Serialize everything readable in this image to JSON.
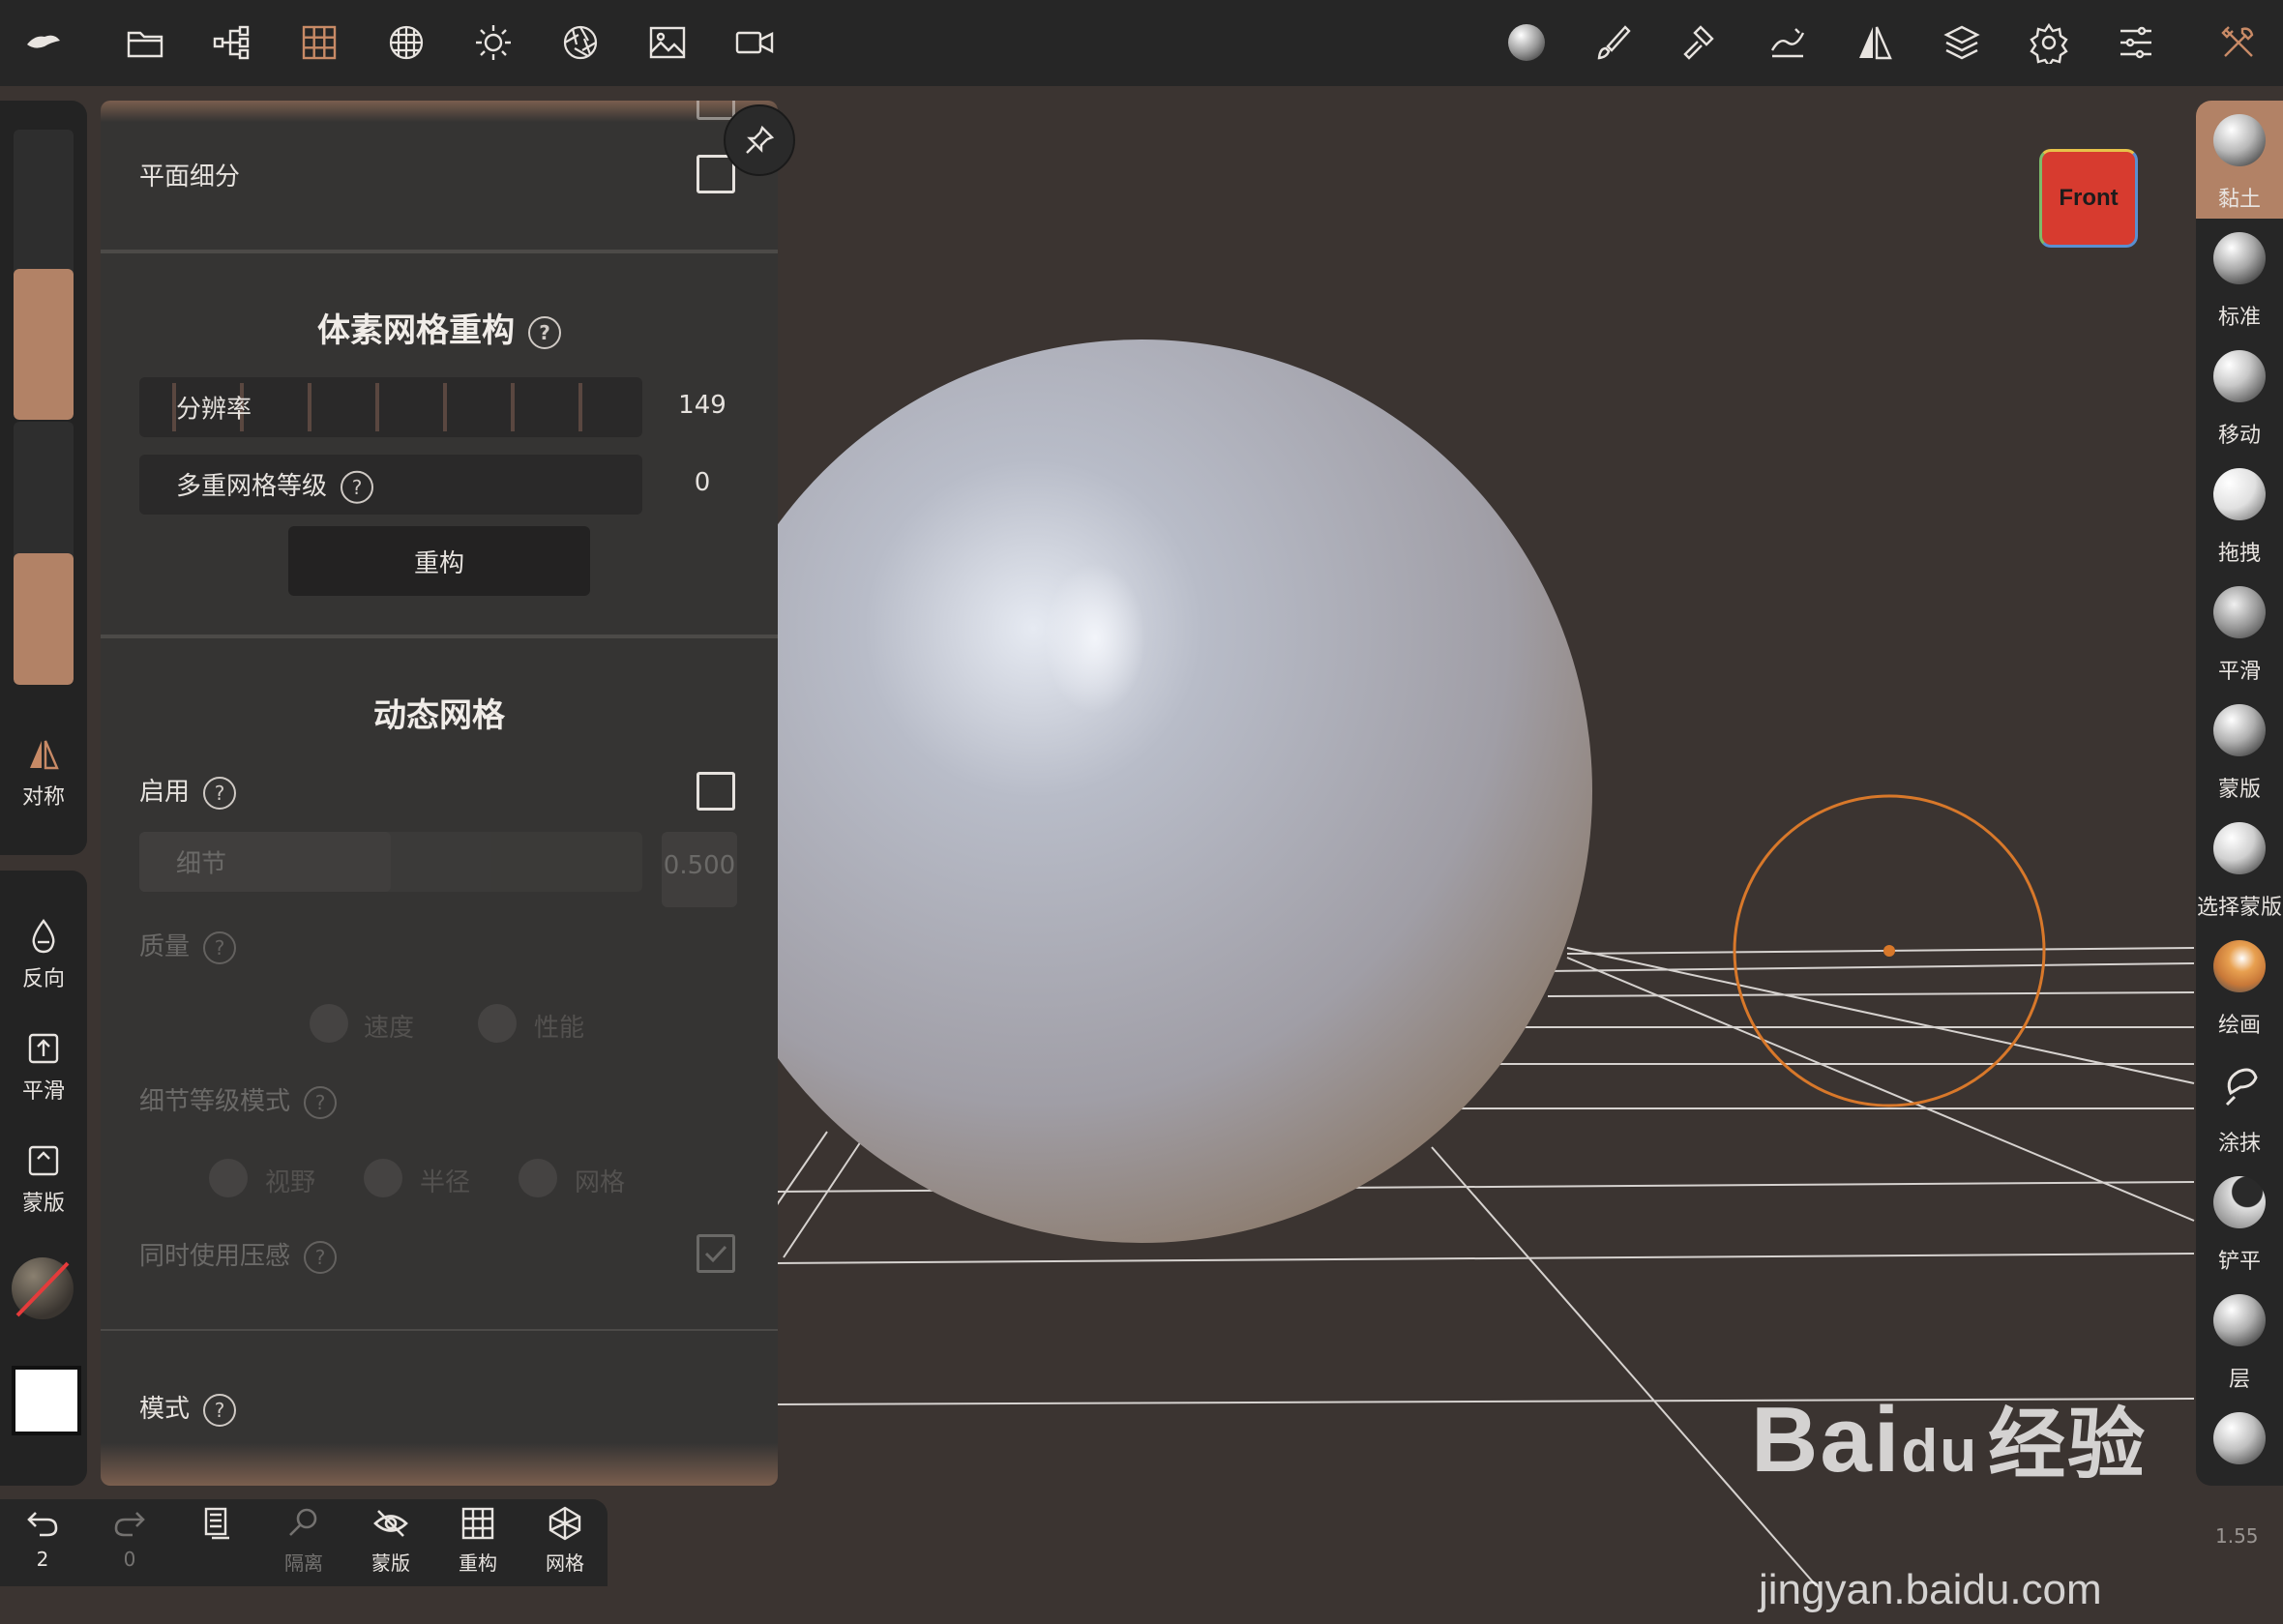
{
  "colors": {
    "accent": "#b28266",
    "brush_ring": "#d8782a",
    "front_cube": "#d73b2f",
    "toolbar_bg": "#262626",
    "viewport_bg": "#3b3431"
  },
  "toolbar": {
    "left_icons": [
      "logo-icon",
      "folder-icon",
      "scene-tree-icon",
      "grid-icon",
      "sphere-grid-icon",
      "sun-icon",
      "aperture-icon",
      "image-icon",
      "video-icon"
    ],
    "right_icons": [
      "material-ball-icon",
      "brush-icon",
      "hammer-icon",
      "stroke-icon",
      "symmetry-icon",
      "layers-icon",
      "gear-icon",
      "sliders-icon",
      "tools-icon"
    ]
  },
  "left_panel": {
    "radius_level": 0.52,
    "intensity_level": 0.5,
    "symmetry_label": "对称",
    "tools": [
      {
        "label": "反向",
        "icon": "drop-icon"
      },
      {
        "label": "平滑",
        "icon": "smooth-icon"
      },
      {
        "label": "蒙版",
        "icon": "mask-icon"
      }
    ]
  },
  "settings": {
    "subdivision": {
      "label": "平面细分",
      "checked": false
    },
    "voxel": {
      "title": "体素网格重构",
      "resolution_label": "分辨率",
      "resolution_value": "149",
      "multires_label": "多重网格等级",
      "multires_value": "0",
      "remesh_button": "重构"
    },
    "dynamic": {
      "title": "动态网格",
      "enable_label": "启用",
      "enable_checked": false,
      "detail_label": "细节",
      "detail_value": "0.500",
      "quality_label": "质量",
      "quality_options": [
        "速度",
        "性能"
      ],
      "detail_mode_label": "细节等级模式",
      "detail_mode_options": [
        "视野",
        "半径",
        "网格"
      ],
      "pressure_label": "同时使用压感",
      "pressure_checked": true
    },
    "mode_label": "模式"
  },
  "front_cube": {
    "label": "Front"
  },
  "brushes": [
    {
      "label": "黏土",
      "active": true
    },
    {
      "label": "标准"
    },
    {
      "label": "移动"
    },
    {
      "label": "拖拽"
    },
    {
      "label": "平滑"
    },
    {
      "label": "蒙版"
    },
    {
      "label": "选择蒙版"
    },
    {
      "label": "绘画"
    },
    {
      "label": "涂抹"
    },
    {
      "label": "铲平"
    },
    {
      "label": "层"
    },
    {
      "label": ""
    }
  ],
  "bottom_bar": {
    "undo_count": "2",
    "redo_count": "0",
    "isolate_label": "隔离",
    "mask_label": "蒙版",
    "remesh_label": "重构",
    "mesh_label": "网格"
  },
  "watermark": {
    "brand": "Bai",
    "paw": "du",
    "cn": "经验",
    "url": "jingyan.baidu.com"
  },
  "zoom_value": "1.55"
}
